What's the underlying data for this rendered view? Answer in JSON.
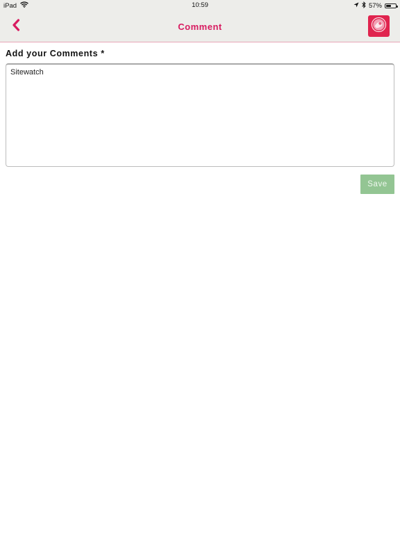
{
  "status_bar": {
    "device": "iPad",
    "time": "10:59",
    "battery_percent_label": "57%",
    "battery_level": 0.57,
    "icons": [
      "wifi-icon",
      "location-arrow-icon",
      "bluetooth-icon",
      "battery-icon"
    ]
  },
  "nav": {
    "title": "Comment",
    "back_icon": "chevron-left-icon",
    "logo_icon": "app-logo-icon"
  },
  "form": {
    "label": "Add your Comments *",
    "comment_value": "Sitewatch",
    "save_label": "Save"
  },
  "colors": {
    "accent": "#d81b60",
    "logo_bg": "#e0244e",
    "nav_bg": "#ededea",
    "save_bg": "#93c593"
  }
}
